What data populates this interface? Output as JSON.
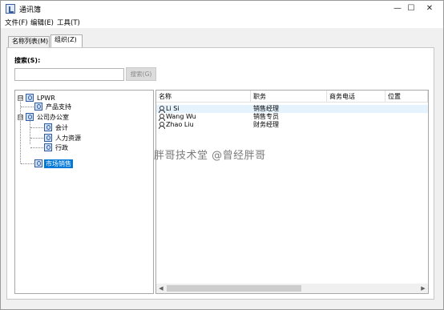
{
  "window": {
    "title": "通讯簿",
    "controls": {
      "minimize": "—",
      "maximize": "☐",
      "close": "✕"
    }
  },
  "menu": [
    "文件(F)",
    "编辑(E)",
    "工具(T)"
  ],
  "tabs": [
    {
      "label": "名称列表(M)",
      "active": false
    },
    {
      "label": "组织(Z)",
      "active": true
    }
  ],
  "search": {
    "label": "搜索(S):",
    "value": "",
    "button_label": "搜索(G)"
  },
  "tree": {
    "root": {
      "label": "LPWR",
      "expander": "⊟"
    },
    "nodes": [
      {
        "label": "产品支持"
      },
      {
        "label": "公司办公室",
        "expander": "⊟"
      },
      {
        "label": "会计"
      },
      {
        "label": "人力资源"
      },
      {
        "label": "行政"
      },
      {
        "label": "市场销售",
        "selected": true
      }
    ]
  },
  "list": {
    "columns": [
      "名称",
      "职务",
      "商务电话",
      "位置"
    ],
    "rows": [
      {
        "name": "Li Si",
        "title": "销售经理",
        "phone": "",
        "location": ""
      },
      {
        "name": "Wang Wu",
        "title": "销售专员",
        "phone": "",
        "location": ""
      },
      {
        "name": "Zhao Liu",
        "title": "财务经理",
        "phone": "",
        "location": ""
      }
    ],
    "scroll_left": "◀",
    "scroll_right": "▶"
  },
  "watermark": "胖哥技术堂 @曾经胖哥",
  "colors": {
    "selection": "#0078d7",
    "hover_row": "#e5f3ff",
    "window_bg": "#f0f0f0"
  }
}
